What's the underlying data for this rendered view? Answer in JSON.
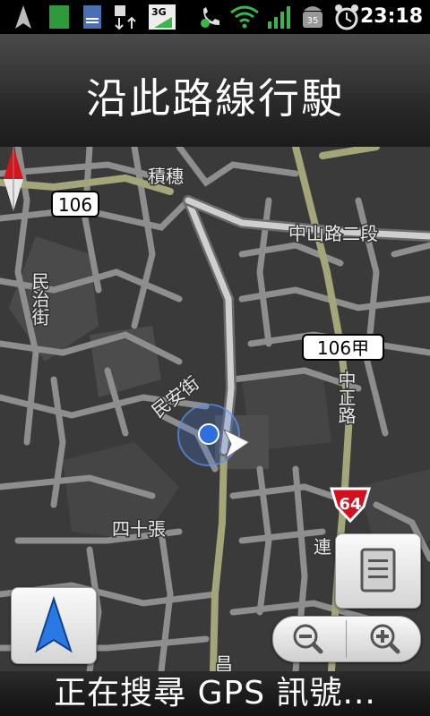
{
  "status_bar": {
    "time": "23:18",
    "network_type": "3G",
    "battery_level": "35",
    "icons": [
      "navigation-arrow-icon",
      "green-square-icon",
      "sd-card-icon",
      "usb-data-icon",
      "3g-signal-icon",
      "phone-icon",
      "wifi-icon",
      "cell-signal-icon",
      "android-battery-icon",
      "alarm-clock-icon"
    ]
  },
  "header": {
    "title": "沿此路線行駛"
  },
  "map": {
    "labels": {
      "jihui": "積穗",
      "zhongshan": "中山路二段",
      "minzhi": "民治街",
      "minan": "民安街",
      "zhongzheng": "中正路",
      "sishizhang": "四十張",
      "lian": "連",
      "lower": "昌"
    },
    "route_shields": {
      "r106": "106",
      "r106jia": "106甲",
      "r64": "64"
    },
    "colors": {
      "background": "#3a3a3a",
      "road": "#9a9a9a",
      "major_road": "#a7a77a",
      "route": "#c8c8c8",
      "shield_red": "#d4101f"
    }
  },
  "footer": {
    "status_text": "正在搜尋 GPS 訊號..."
  },
  "controls": {
    "nav_icon": "navigation-arrow-icon",
    "menu_icon": "menu-list-icon",
    "zoom_out_icon": "zoom-out-icon",
    "zoom_in_icon": "zoom-in-icon"
  }
}
